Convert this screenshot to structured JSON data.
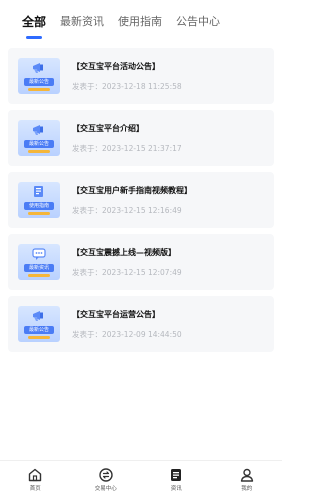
{
  "tabs": [
    {
      "label": "全部",
      "active": true
    },
    {
      "label": "最新资讯",
      "active": false
    },
    {
      "label": "使用指南",
      "active": false
    },
    {
      "label": "公告中心",
      "active": false
    }
  ],
  "articles": [
    {
      "thumb_label": "最新公告",
      "thumb_icon": "megaphone-icon",
      "title": "【交互宝平台活动公告】",
      "date": "发表于：2023-12-18 11:25:58"
    },
    {
      "thumb_label": "最新公告",
      "thumb_icon": "megaphone-icon",
      "title": "【交互宝平台介绍】",
      "date": "发表于：2023-12-15 21:37:17"
    },
    {
      "thumb_label": "使用指南",
      "thumb_icon": "book-icon",
      "title": "【交互宝用户新手指南视频教程】",
      "date": "发表于：2023-12-15 12:16:49"
    },
    {
      "thumb_label": "最新资讯",
      "thumb_icon": "chat-bubble-icon",
      "title": "【交互宝震撼上线—视频版】",
      "date": "发表于：2023-12-15 12:07:49"
    },
    {
      "thumb_label": "最新公告",
      "thumb_icon": "megaphone-icon",
      "title": "【交互宝平台运营公告】",
      "date": "发表于：2023-12-09 14:44:50"
    }
  ],
  "bottom_nav": [
    {
      "label": "首页",
      "icon": "home-icon",
      "active": false
    },
    {
      "label": "交易中心",
      "icon": "exchange-icon",
      "active": false
    },
    {
      "label": "资讯",
      "icon": "news-icon",
      "active": true
    },
    {
      "label": "我的",
      "icon": "user-icon",
      "active": false
    }
  ],
  "colors": {
    "accent": "#2f6bff",
    "thumb_tag": "#4a7cf5",
    "thumb_bar": "#f5b63a"
  }
}
